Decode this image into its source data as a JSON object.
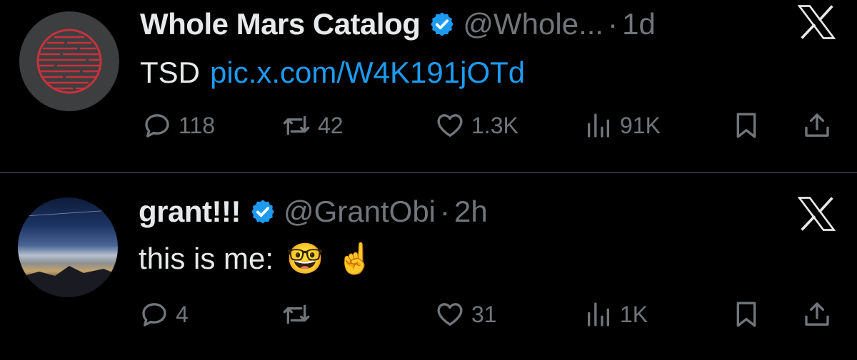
{
  "tweets": [
    {
      "name": "Whole Mars Catalog",
      "handle": "@Whole...",
      "separator": "·",
      "time": "1d",
      "text": "TSD",
      "link": "pic.x.com/W4K191jOTd",
      "replies": "118",
      "retweets": "42",
      "likes": "1.3K",
      "views": "91K"
    },
    {
      "name": "grant!!!",
      "handle": "@GrantObi",
      "separator": "·",
      "time": "2h",
      "text": "this is me:",
      "emoji_1": "🤓",
      "emoji_2": "☝️",
      "replies": "4",
      "retweets": "",
      "likes": "31",
      "views": "1K"
    }
  ],
  "colors": {
    "background": "#000000",
    "text": "#e7e9ea",
    "muted": "#71767b",
    "link": "#1d9bf0",
    "verified": "#1d9bf0",
    "divider": "#2f3336"
  },
  "icons": [
    "verified-badge-icon",
    "x-logo-icon",
    "reply-icon",
    "retweet-icon",
    "like-icon",
    "views-icon",
    "bookmark-icon",
    "share-icon"
  ]
}
